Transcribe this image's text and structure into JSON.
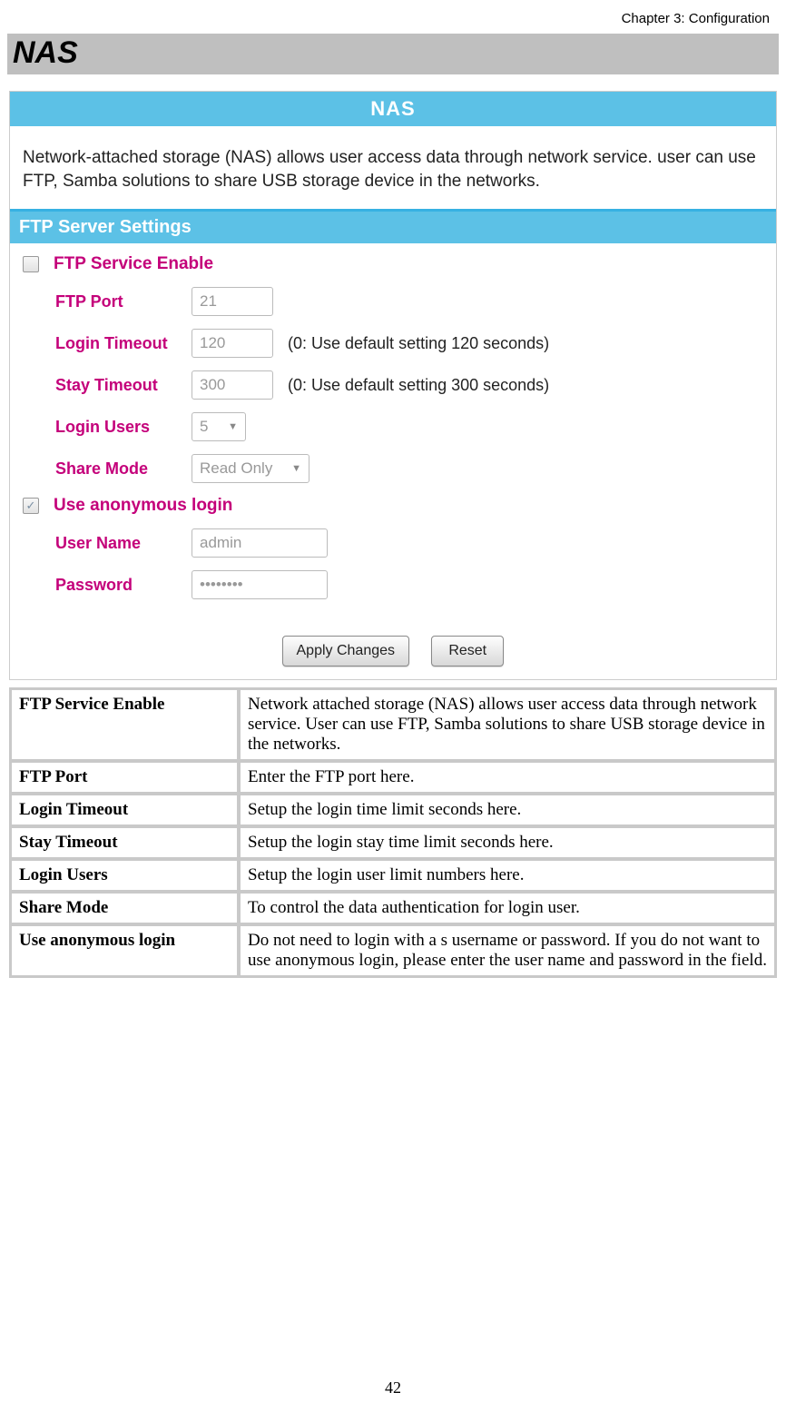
{
  "page": {
    "header": "Chapter 3: Configuration",
    "section_title": "NAS",
    "page_number": "42"
  },
  "nas_panel": {
    "title": "NAS",
    "description": "Network-attached storage (NAS) allows user access data through network service. user can use FTP, Samba solutions to share USB storage device in the networks.",
    "ftp_settings_title": "FTP Server Settings"
  },
  "form": {
    "ftp_enable_label": "FTP Service Enable",
    "ftp_port_label": "FTP Port",
    "ftp_port_value": "21",
    "login_timeout_label": "Login Timeout",
    "login_timeout_value": "120",
    "login_timeout_hint": "(0: Use default setting 120 seconds)",
    "stay_timeout_label": "Stay Timeout",
    "stay_timeout_value": "300",
    "stay_timeout_hint": "(0: Use default setting 300 seconds)",
    "login_users_label": "Login Users",
    "login_users_value": "5",
    "share_mode_label": "Share Mode",
    "share_mode_value": "Read Only",
    "anon_login_label": "Use anonymous login",
    "user_name_label": "User Name",
    "user_name_value": "admin",
    "password_label": "Password",
    "password_value": "••••••••",
    "apply_btn": "Apply Changes",
    "reset_btn": "Reset"
  },
  "table_rows": [
    {
      "key": "FTP Service Enable",
      "val": "Network attached storage (NAS) allows user access data through network service. User can use FTP, Samba solutions to share USB storage device in the networks."
    },
    {
      "key": "FTP Port",
      "val": "Enter the FTP port here."
    },
    {
      "key": "Login Timeout",
      "val": "Setup the login time limit seconds here."
    },
    {
      "key": "Stay Timeout",
      "val": "Setup the login stay time limit seconds here."
    },
    {
      "key": "Login Users",
      "val": "Setup the login user limit numbers here."
    },
    {
      "key": "Share Mode",
      "val": "To control the data authentication for login user."
    },
    {
      "key": "Use anonymous login",
      "val": "Do not need to login with a s username or password. If you do not want to use anonymous login, please enter the user name and password in the field."
    }
  ]
}
